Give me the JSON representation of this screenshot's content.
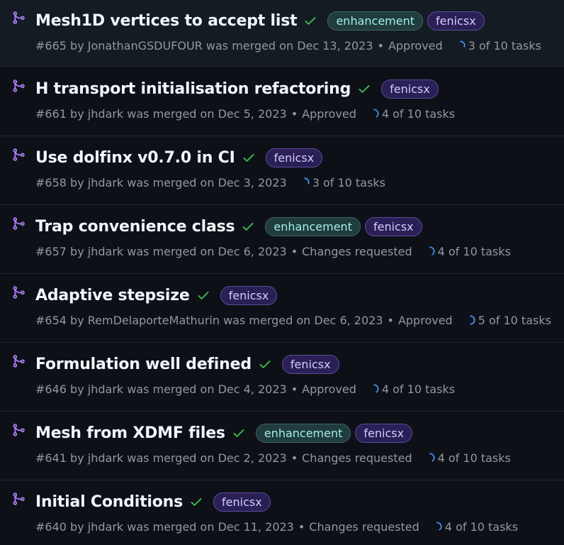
{
  "colors": {
    "merged_icon": "#ab7df8",
    "check": "#3fb950",
    "progress": "#4493f8",
    "label_enhancement": "#a2eeef",
    "label_fenicsx": "#d7ccff"
  },
  "icons": {
    "merged": "git-merge-icon",
    "status": "check-icon",
    "tasks": "progress-circle-icon"
  },
  "pull_requests": [
    {
      "title": "Mesh1D vertices to accept list",
      "labels": [
        "enhancement",
        "fenicsx"
      ],
      "number": "#665",
      "by": "by",
      "author": "JonathanGSDUFOUR",
      "merged_text": "was merged on",
      "date": "Dec 13, 2023",
      "review": "Approved",
      "tasks": "3 of 10 tasks",
      "tasks_done": 3,
      "tasks_total": 10
    },
    {
      "title": "H transport initialisation refactoring",
      "labels": [
        "fenicsx"
      ],
      "number": "#661",
      "by": "by",
      "author": "jhdark",
      "merged_text": "was merged on",
      "date": "Dec 5, 2023",
      "review": "Approved",
      "tasks": "4 of 10 tasks",
      "tasks_done": 4,
      "tasks_total": 10
    },
    {
      "title": "Use dolfinx v0.7.0 in CI",
      "labels": [
        "fenicsx"
      ],
      "number": "#658",
      "by": "by",
      "author": "jhdark",
      "merged_text": "was merged on",
      "date": "Dec 3, 2023",
      "review": "",
      "tasks": "3 of 10 tasks",
      "tasks_done": 3,
      "tasks_total": 10
    },
    {
      "title": "Trap convenience class",
      "labels": [
        "enhancement",
        "fenicsx"
      ],
      "number": "#657",
      "by": "by",
      "author": "jhdark",
      "merged_text": "was merged on",
      "date": "Dec 6, 2023",
      "review": "Changes requested",
      "tasks": "4 of 10 tasks",
      "tasks_done": 4,
      "tasks_total": 10
    },
    {
      "title": "Adaptive stepsize",
      "labels": [
        "fenicsx"
      ],
      "number": "#654",
      "by": "by",
      "author": "RemDelaporteMathurin",
      "merged_text": "was merged on",
      "date": "Dec 6, 2023",
      "review": "Approved",
      "tasks": "5 of 10 tasks",
      "tasks_done": 5,
      "tasks_total": 10
    },
    {
      "title": "Formulation well defined",
      "labels": [
        "fenicsx"
      ],
      "number": "#646",
      "by": "by",
      "author": "jhdark",
      "merged_text": "was merged on",
      "date": "Dec 4, 2023",
      "review": "Approved",
      "tasks": "4 of 10 tasks",
      "tasks_done": 4,
      "tasks_total": 10
    },
    {
      "title": "Mesh from XDMF files",
      "labels": [
        "enhancement",
        "fenicsx"
      ],
      "number": "#641",
      "by": "by",
      "author": "jhdark",
      "merged_text": "was merged on",
      "date": "Dec 2, 2023",
      "review": "Changes requested",
      "tasks": "4 of 10 tasks",
      "tasks_done": 4,
      "tasks_total": 10
    },
    {
      "title": "Initial Conditions",
      "labels": [
        "fenicsx"
      ],
      "number": "#640",
      "by": "by",
      "author": "jhdark",
      "merged_text": "was merged on",
      "date": "Dec 11, 2023",
      "review": "Changes requested",
      "tasks": "4 of 10 tasks",
      "tasks_done": 4,
      "tasks_total": 10
    }
  ]
}
